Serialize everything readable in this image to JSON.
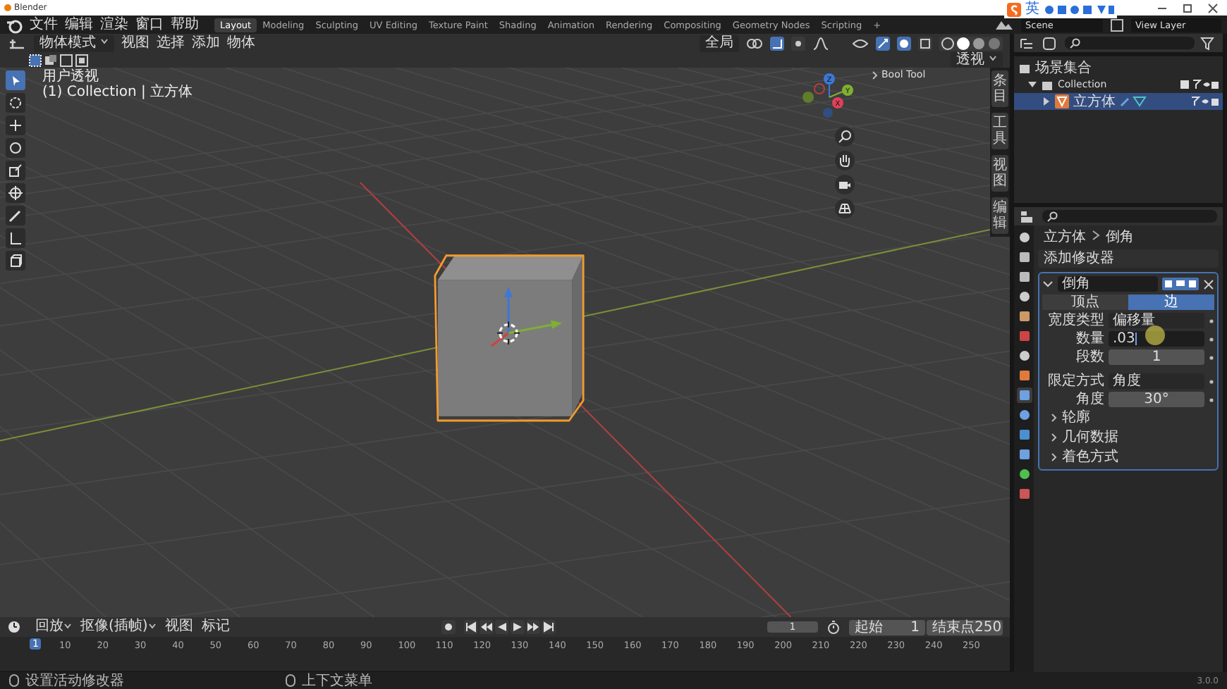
{
  "window": {
    "title": "Blender"
  },
  "ime_toolbar": {
    "label": "英"
  },
  "menu": [
    "文件",
    "编辑",
    "渲染",
    "窗口",
    "帮助"
  ],
  "workspaces": [
    {
      "label": "Layout",
      "selected": true
    },
    {
      "label": "Modeling",
      "selected": false
    },
    {
      "label": "Sculpting",
      "selected": false
    },
    {
      "label": "UV Editing",
      "selected": false
    },
    {
      "label": "Texture Paint",
      "selected": false
    },
    {
      "label": "Shading",
      "selected": false
    },
    {
      "label": "Animation",
      "selected": false
    },
    {
      "label": "Rendering",
      "selected": false
    },
    {
      "label": "Compositing",
      "selected": false
    },
    {
      "label": "Geometry Nodes",
      "selected": false
    },
    {
      "label": "Scripting",
      "selected": false
    }
  ],
  "add_workspace": "+",
  "scene": "Scene",
  "view_layer": "View Layer",
  "viewport": {
    "mode": "物体模式",
    "menus": [
      "视图",
      "选择",
      "添加",
      "物体"
    ],
    "orientation": "全局",
    "perspective_menu": "透视",
    "view_name": "用户透视",
    "object_info": "(1) Collection | 立方体",
    "sidebar_panel": "Bool Tool",
    "side_tabs": [
      "条目",
      "工具",
      "视图",
      "编辑"
    ],
    "gizmo_axes": [
      "Z",
      "Y",
      "X"
    ]
  },
  "outliner": {
    "items": [
      {
        "label": "场景集合",
        "selected": false,
        "children": [
          {
            "label": "Collection",
            "selected": false,
            "children": [
              {
                "label": "立方体",
                "selected": true
              }
            ]
          }
        ]
      }
    ]
  },
  "properties": {
    "breadcrumb": [
      "立方体",
      "倒角"
    ],
    "add_modifier": "添加修改器",
    "modifier": {
      "name": "倒角",
      "modes": [
        {
          "label": "顶点",
          "selected": false
        },
        {
          "label": "边",
          "selected": true
        }
      ],
      "fields": [
        {
          "kind": "dropdown",
          "label": "宽度类型",
          "value": "偏移量"
        },
        {
          "kind": "input",
          "label": "数量",
          "value": ".03"
        },
        {
          "kind": "number",
          "label": "段数",
          "value": "1"
        },
        {
          "kind": "dropdown",
          "label": "限定方式",
          "value": "角度"
        },
        {
          "kind": "number",
          "label": "角度",
          "value": "30°"
        }
      ],
      "sections": [
        "轮廓",
        "几何数据",
        "着色方式"
      ]
    }
  },
  "timeline": {
    "menus": [
      "回放",
      "抠像(插帧)",
      "视图",
      "标记"
    ],
    "current_frame": "1",
    "start_label": "起始",
    "start": "1",
    "end_label": "结束点",
    "end": "250",
    "playhead": "1",
    "ticks": [
      "10",
      "20",
      "30",
      "40",
      "50",
      "60",
      "70",
      "80",
      "90",
      "100",
      "110",
      "120",
      "130",
      "140",
      "150",
      "160",
      "170",
      "180",
      "190",
      "200",
      "210",
      "220",
      "230",
      "240",
      "250"
    ]
  },
  "status_bar": {
    "hints": [
      "设置活动修改器",
      "上下文菜单"
    ],
    "version": "3.0.0"
  }
}
